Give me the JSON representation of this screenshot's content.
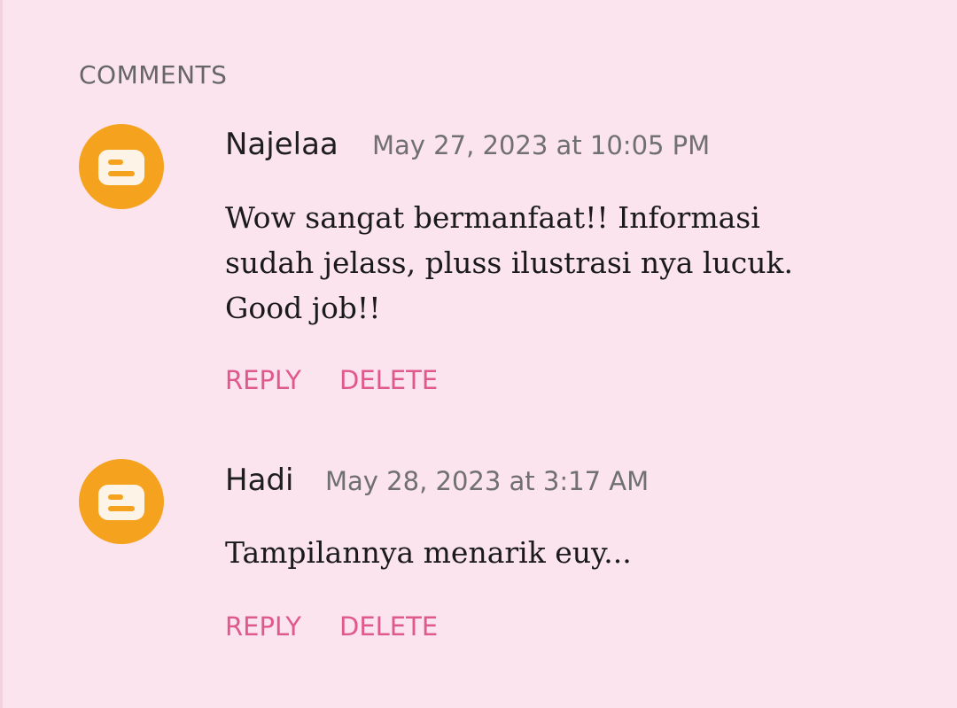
{
  "section": {
    "title": "COMMENTS"
  },
  "colors": {
    "background": "#fce4ee",
    "avatar": "#f5a21e",
    "action": "#e0598b",
    "muted": "#707070"
  },
  "comments": [
    {
      "avatar_icon": "blogger-icon",
      "author": "Najelaa",
      "timestamp": "May 27, 2023 at 10:05 PM",
      "body_lines": [
        "Wow sangat bermanfaat!! Informasi",
        "sudah jelass, pluss ilustrasi nya lucuk.",
        "Good job!!"
      ],
      "reply_label": "REPLY",
      "delete_label": "DELETE"
    },
    {
      "avatar_icon": "blogger-icon",
      "author": "Hadi",
      "timestamp": "May 28, 2023 at 3:17 AM",
      "body_lines": [
        "Tampilannya menarik euy..."
      ],
      "reply_label": "REPLY",
      "delete_label": "DELETE"
    }
  ]
}
